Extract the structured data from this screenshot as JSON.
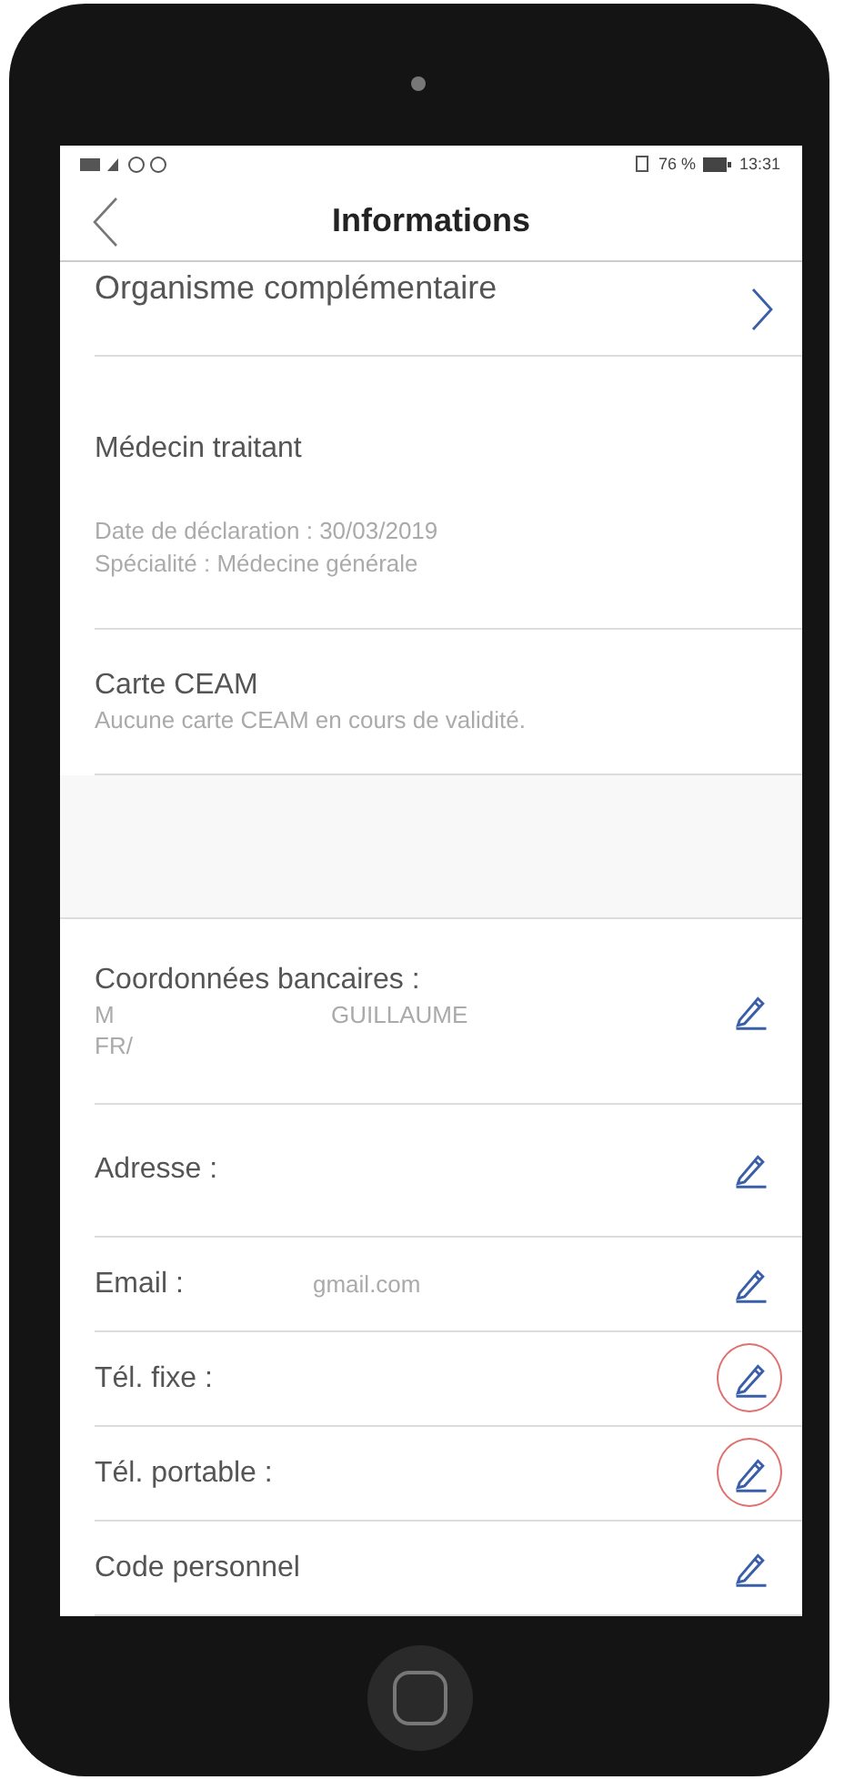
{
  "status_bar": {
    "battery": "76 %",
    "time": "13:31"
  },
  "header": {
    "title": "Informations"
  },
  "rows": [
    {
      "kind": "link",
      "title": "Organisme complémentaire"
    },
    {
      "kind": "info",
      "title": "Médecin traitant",
      "lines": [
        "Date de déclaration : 30/03/2019",
        "Spécialité : Médecine générale"
      ]
    },
    {
      "kind": "info",
      "title": "Carte CEAM",
      "lines": [
        "Aucune carte CEAM en cours de validité."
      ]
    },
    {
      "kind": "spacer"
    },
    {
      "kind": "edit",
      "title": "Coordonnées bancaires :",
      "values": [
        "M",
        "GUILLAUME"
      ],
      "lines": [
        "FR/"
      ],
      "highlighted": false
    },
    {
      "kind": "edit",
      "title": "Adresse :",
      "highlighted": false
    },
    {
      "kind": "edit",
      "title": "Email :",
      "values": [
        "gmail.com"
      ],
      "highlighted": false
    },
    {
      "kind": "edit",
      "title": "Tél. fixe :",
      "highlighted": true
    },
    {
      "kind": "edit",
      "title": "Tél. portable :",
      "highlighted": true
    },
    {
      "kind": "edit",
      "title": "Code personnel",
      "highlighted": false
    }
  ]
}
